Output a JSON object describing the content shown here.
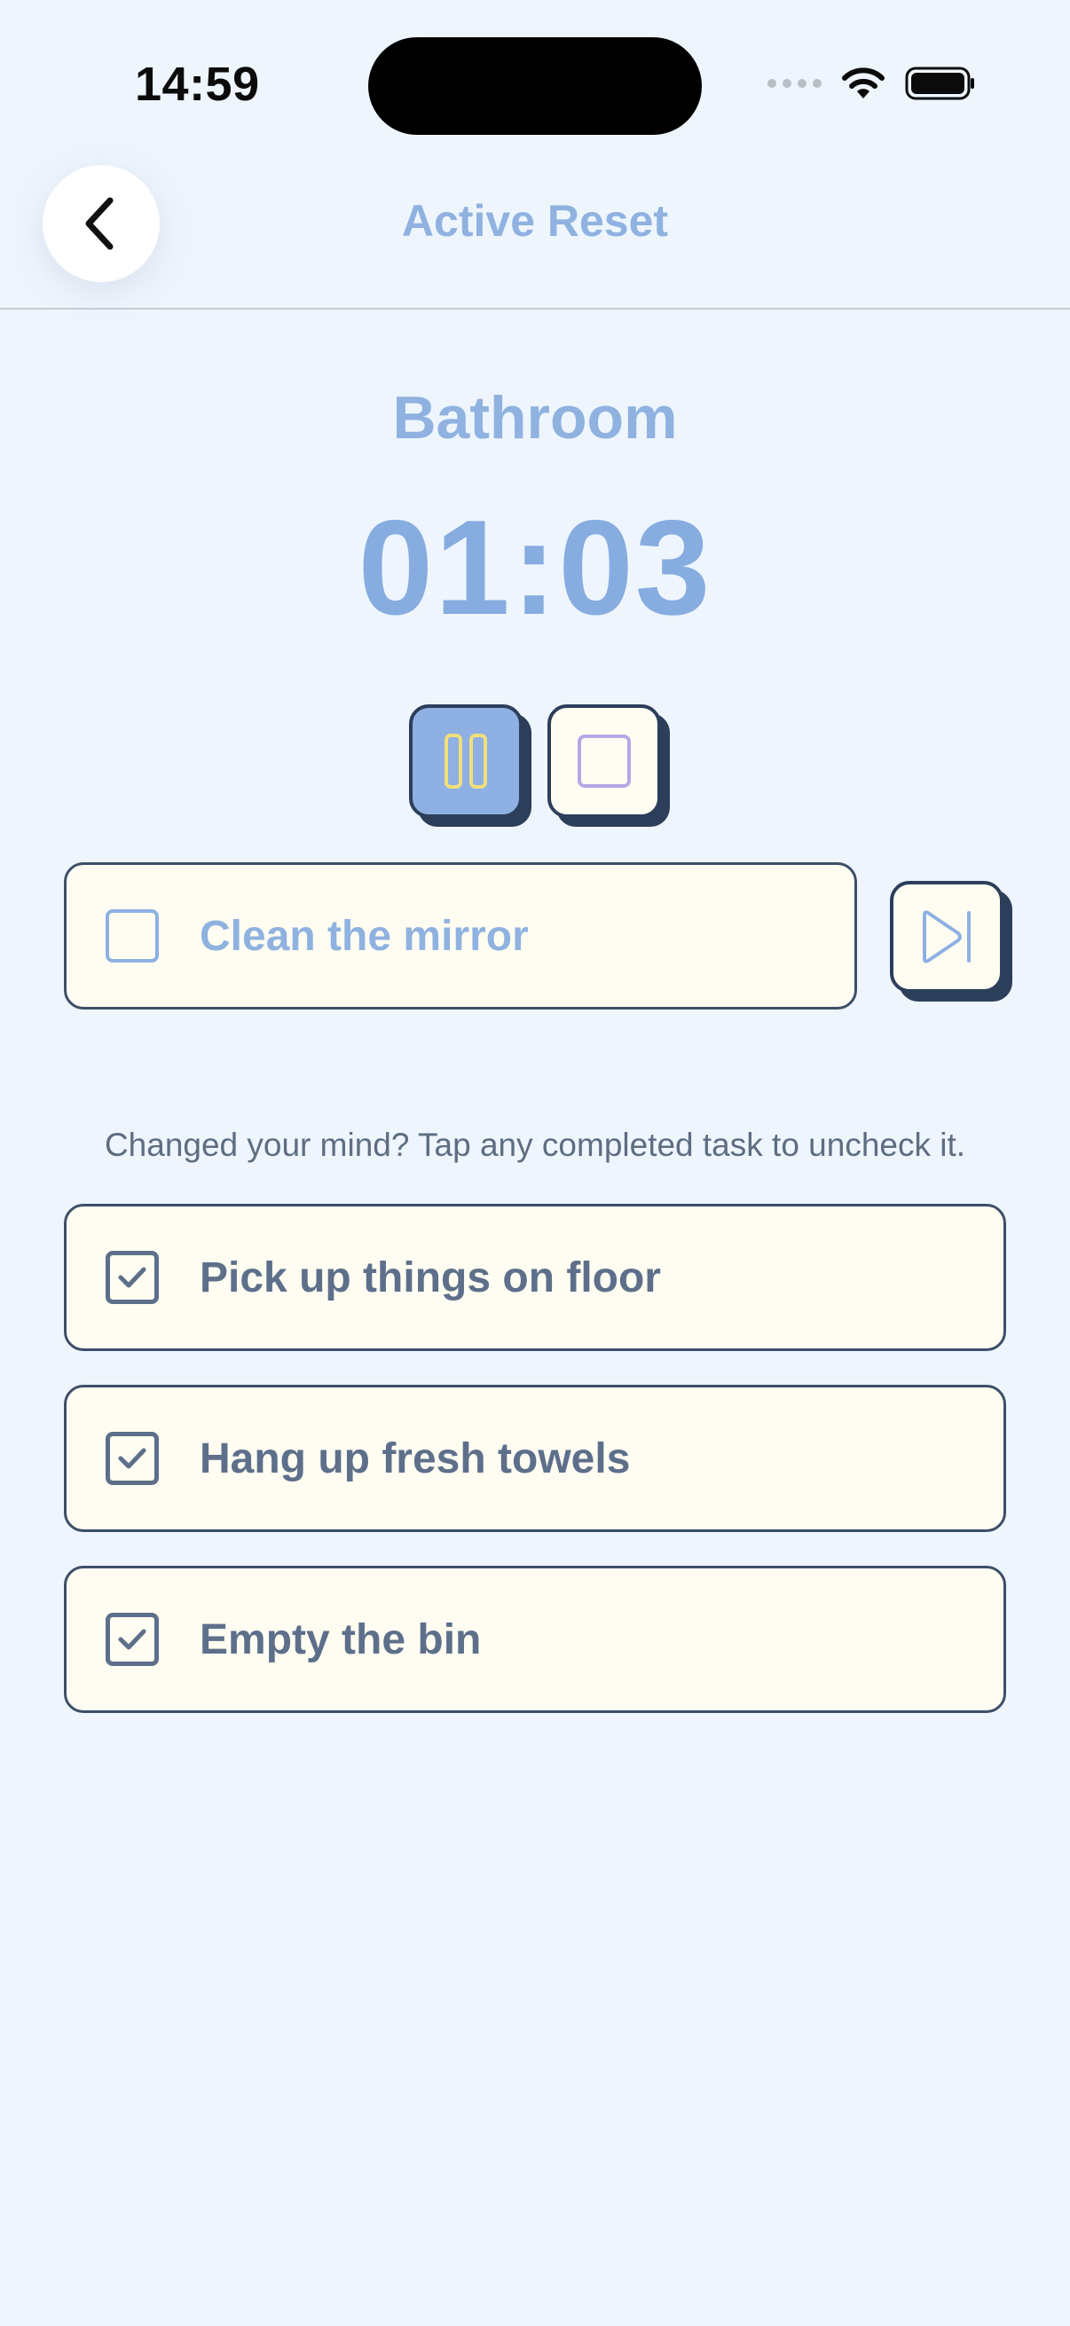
{
  "status_bar": {
    "time": "14:59",
    "icons": [
      "cellular-dots-icon",
      "wifi-icon",
      "battery-icon"
    ]
  },
  "nav": {
    "back_icon": "chevron-left-icon",
    "title": "Active Reset"
  },
  "room": {
    "title": "Bathroom"
  },
  "timer": {
    "display": "01:03"
  },
  "controls": {
    "pause_icon": "pause-icon",
    "stop_icon": "stop-icon",
    "skip_icon": "skip-next-icon"
  },
  "current_task": {
    "label": "Clean the mirror",
    "checked": false
  },
  "hint": "Changed your mind? Tap any completed task to uncheck it.",
  "completed_tasks": [
    {
      "label": "Pick up things on floor",
      "checked": true
    },
    {
      "label": "Hang up fresh towels",
      "checked": true
    },
    {
      "label": "Empty the bin",
      "checked": true
    }
  ],
  "colors": {
    "background": "#eef5fd",
    "accent_blue": "#8eb0e3",
    "card_bg": "#fffdf2",
    "outline_dark": "#2c3e5a",
    "text_done": "#5d6f8a",
    "pause_icon_yellow": "#f2df7a",
    "stop_icon_purple": "#b8a6e6"
  }
}
